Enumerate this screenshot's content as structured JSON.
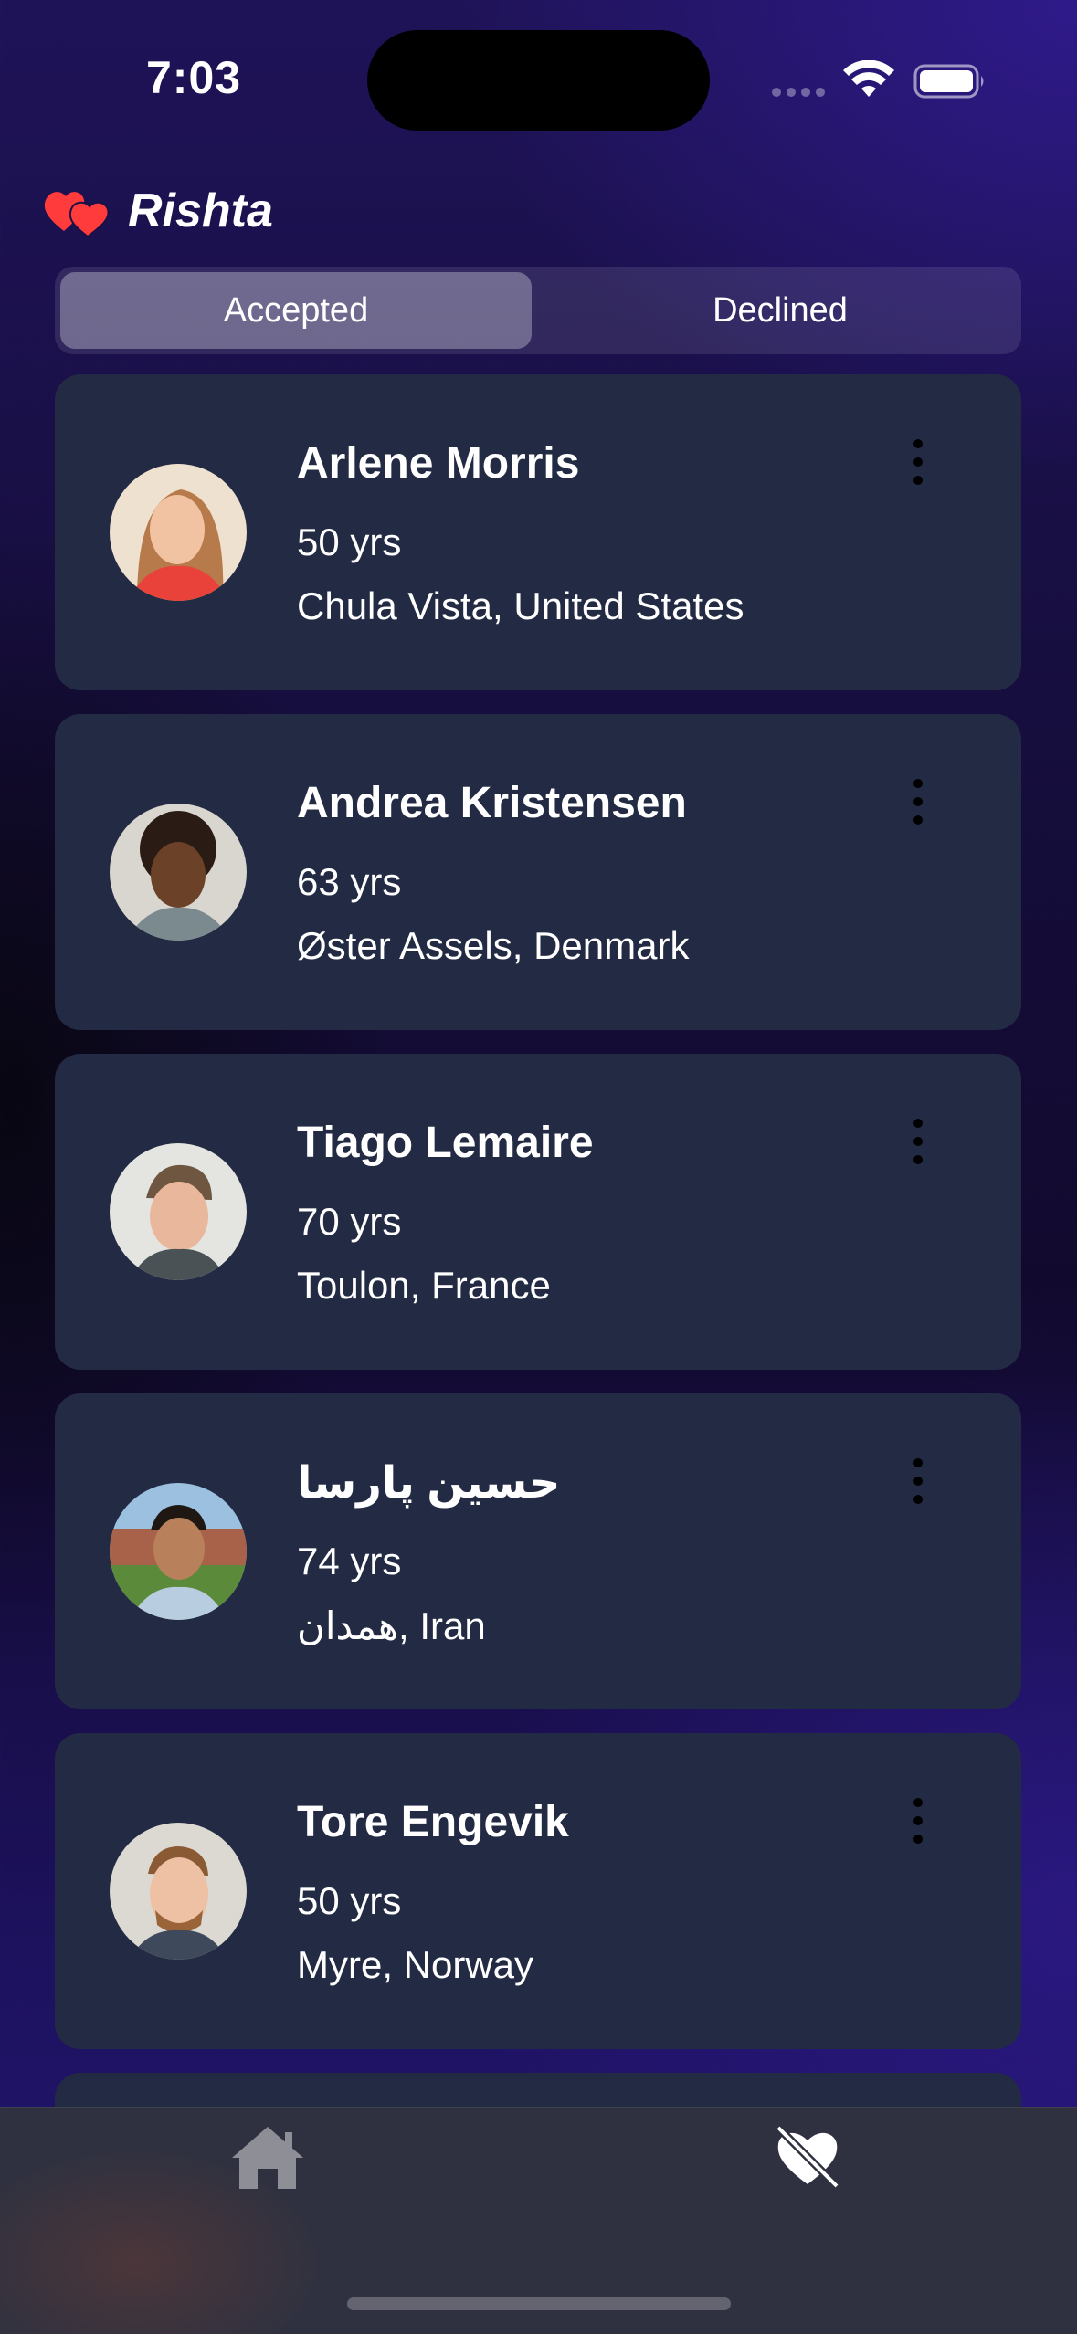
{
  "status_bar": {
    "time": "7:03"
  },
  "app": {
    "title": "Rishta"
  },
  "tabs": {
    "accepted_label": "Accepted",
    "declined_label": "Declined",
    "selected": "Accepted"
  },
  "profiles": [
    {
      "name": "Arlene Morris",
      "age": "50 yrs",
      "location": "Chula Vista, United States"
    },
    {
      "name": "Andrea Kristensen",
      "age": "63 yrs",
      "location": "Øster Assels, Denmark"
    },
    {
      "name": "Tiago Lemaire",
      "age": "70 yrs",
      "location": "Toulon, France"
    },
    {
      "name": "حسين پارسا",
      "age": "74 yrs",
      "location": "همدان, Iran"
    },
    {
      "name": "Tore Engevik",
      "age": "50 yrs",
      "location": "Myre, Norway"
    }
  ],
  "colors": {
    "accent_heart": "#ff3b3b",
    "card_bg": "#232a43",
    "tab_bar_bg": "#2f3140"
  },
  "bottom_nav": {
    "items": [
      "home-icon",
      "heart-slash-icon"
    ]
  }
}
